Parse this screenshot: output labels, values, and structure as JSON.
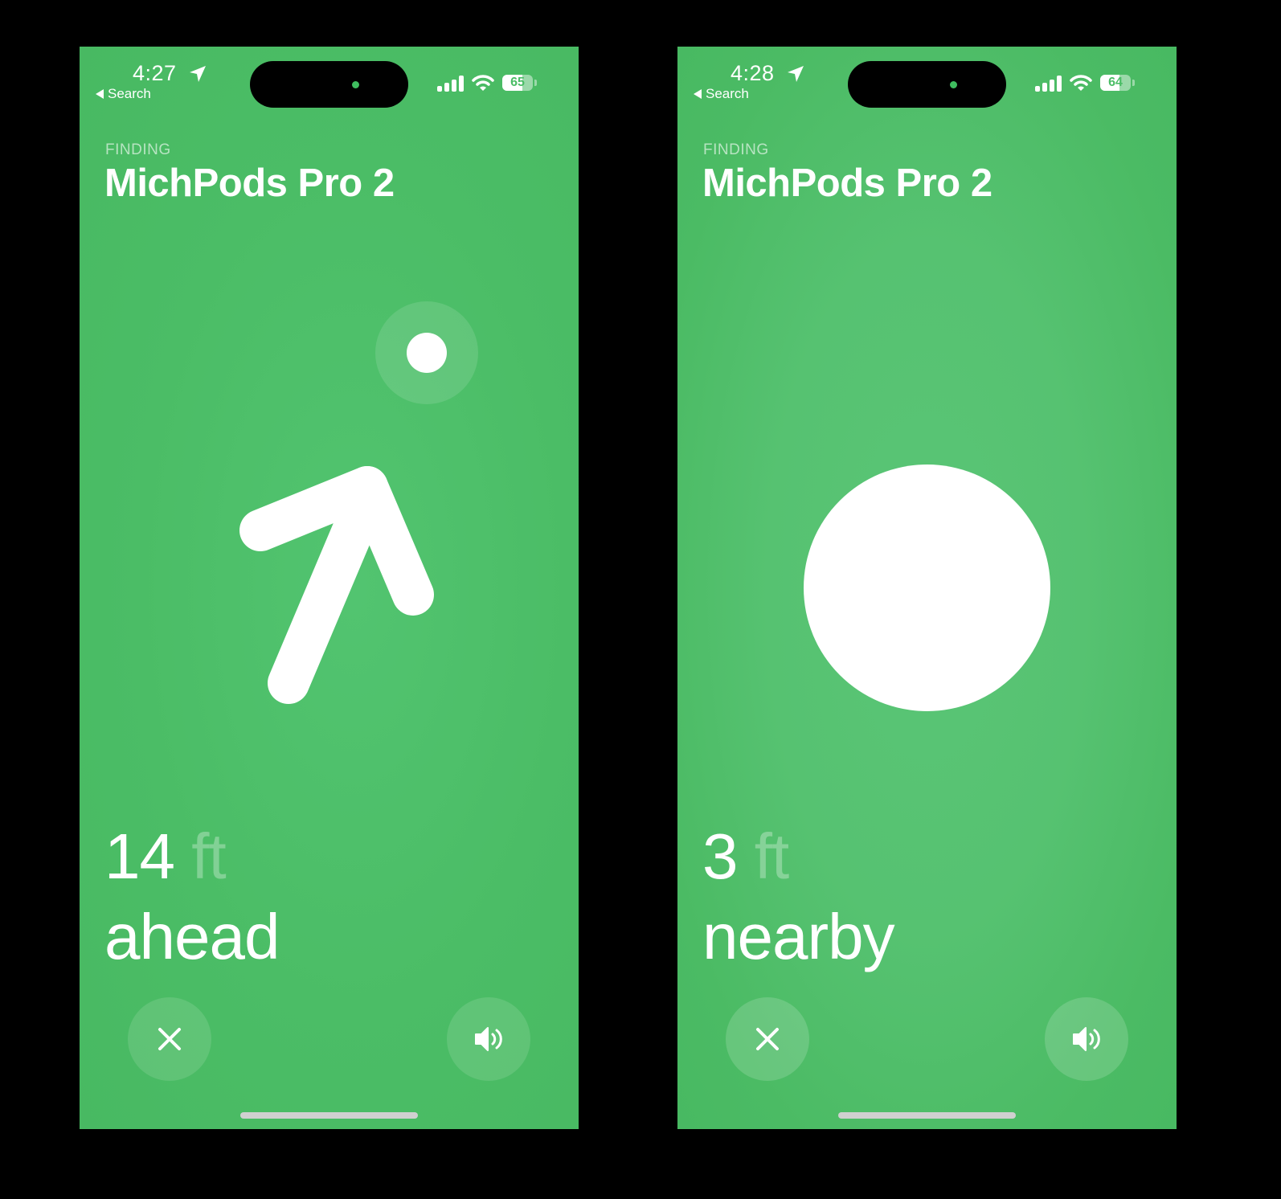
{
  "screens": [
    {
      "status_bar": {
        "time": "4:27",
        "back_label": "Search",
        "battery_percent": "65",
        "battery_level": 0.65
      },
      "header": {
        "eyebrow": "FINDING",
        "device_name": "MichPods Pro 2"
      },
      "indicator": {
        "type": "direction-arrow",
        "icon": "arrow-up-right-icon"
      },
      "distance": {
        "value": "14",
        "unit": "ft"
      },
      "direction_text": "ahead",
      "buttons": {
        "close_icon": "close-icon",
        "sound_icon": "speaker-wave-icon"
      }
    },
    {
      "status_bar": {
        "time": "4:28",
        "back_label": "Search",
        "battery_percent": "64",
        "battery_level": 0.64
      },
      "header": {
        "eyebrow": "FINDING",
        "device_name": "MichPods Pro 2"
      },
      "indicator": {
        "type": "proximity-circle",
        "icon": "proximity-dot-icon"
      },
      "distance": {
        "value": "3",
        "unit": "ft"
      },
      "direction_text": "nearby",
      "buttons": {
        "close_icon": "close-icon",
        "sound_icon": "speaker-wave-icon"
      }
    }
  ],
  "colors": {
    "background_green": "#4bbd66",
    "text_white": "#ffffff",
    "frame_black": "#000000",
    "home_indicator": "#d0d0d0"
  }
}
